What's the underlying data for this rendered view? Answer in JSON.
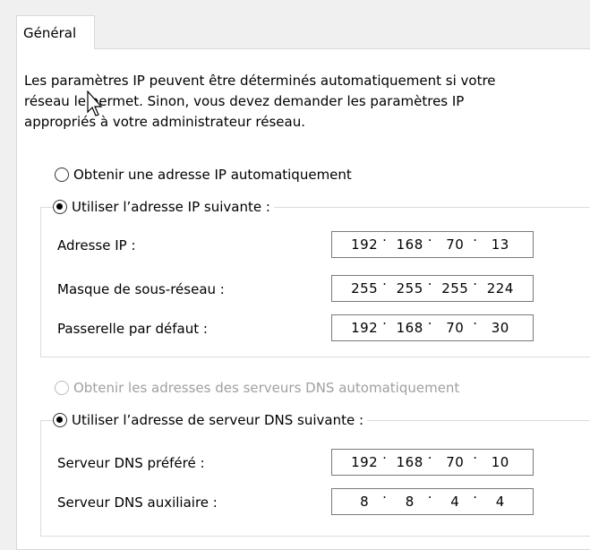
{
  "tab": {
    "label": "Général"
  },
  "description": {
    "line1": "Les paramètres IP peuvent être déterminés automatiquement si votre",
    "line2": "réseau le permet. Sinon, vous devez demander les paramètres IP",
    "line3": "appropriés à votre administrateur réseau."
  },
  "ip": {
    "auto_label": "Obtenir une adresse IP automatiquement",
    "manual_label": "Utiliser l’adresse IP suivante :",
    "fields": [
      {
        "label": "Adresse IP :",
        "octets": [
          "192",
          "168",
          "70",
          "13"
        ]
      },
      {
        "label": "Masque de sous-réseau :",
        "octets": [
          "255",
          "255",
          "255",
          "224"
        ]
      },
      {
        "label": "Passerelle par défaut :",
        "octets": [
          "192",
          "168",
          "70",
          "30"
        ]
      }
    ]
  },
  "dns": {
    "auto_label": "Obtenir les adresses des serveurs DNS automatiquement",
    "manual_label": "Utiliser l’adresse de serveur DNS suivante :",
    "fields": [
      {
        "label": "Serveur DNS préféré :",
        "octets": [
          "192",
          "168",
          "70",
          "10"
        ]
      },
      {
        "label": "Serveur DNS auxiliaire :",
        "octets": [
          "8",
          "8",
          "4",
          "4"
        ]
      }
    ]
  },
  "colors": {
    "panel": "#ffffff",
    "window": "#f0f0f0",
    "border": "#7a7a7a",
    "disabled": "#a0a0a0"
  }
}
